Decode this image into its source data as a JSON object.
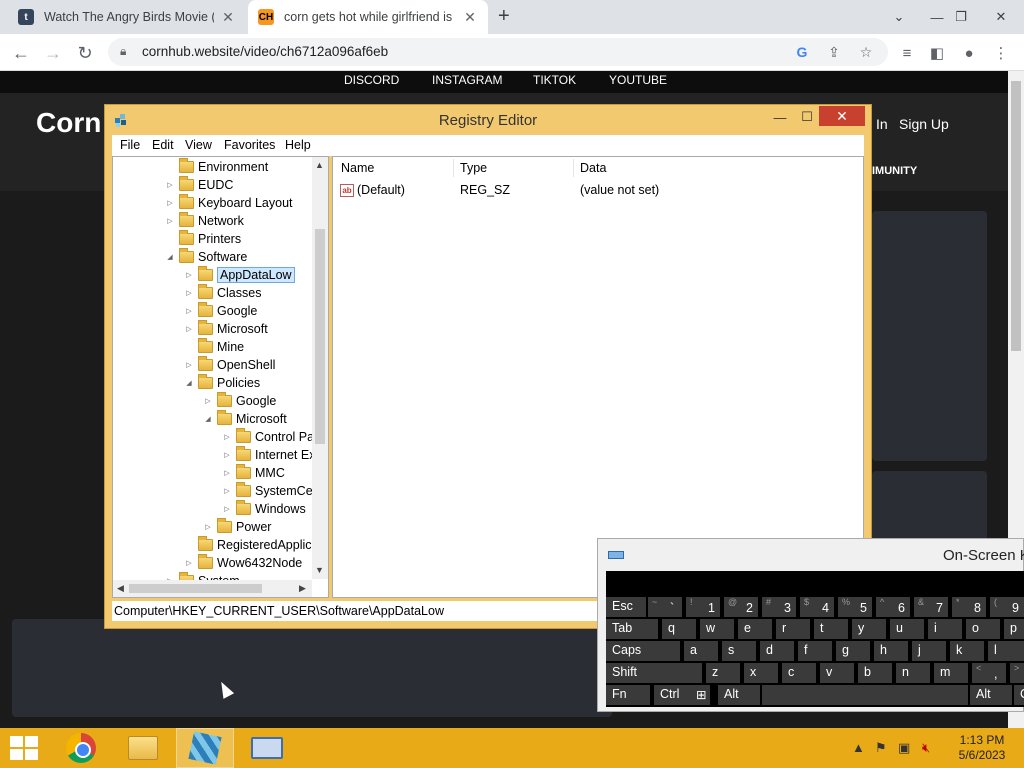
{
  "browser": {
    "tabs": [
      {
        "title": "Watch The Angry Birds Movie (2(",
        "favicon": "tumblr-icon",
        "active": false
      },
      {
        "title": "corn gets hot while girlfriend is b",
        "favicon": "CH",
        "active": true
      }
    ],
    "url": "cornhub.website/video/ch6712a096af6eb"
  },
  "site": {
    "nav": [
      "DISCORD",
      "INSTAGRAM",
      "TIKTOK",
      "YOUTUBE"
    ],
    "logo": "Corn",
    "login_partial": "In",
    "signup": "Sign Up",
    "community_partial": "IMUNITY"
  },
  "regedit": {
    "title": "Registry Editor",
    "menu": [
      "File",
      "Edit",
      "View",
      "Favorites",
      "Help"
    ],
    "tree": [
      {
        "label": "Environment",
        "expander": "",
        "depth": 0
      },
      {
        "label": "EUDC",
        "expander": "closed",
        "depth": 0
      },
      {
        "label": "Keyboard Layout",
        "expander": "closed",
        "depth": 0
      },
      {
        "label": "Network",
        "expander": "closed",
        "depth": 0
      },
      {
        "label": "Printers",
        "expander": "",
        "depth": 0
      },
      {
        "label": "Software",
        "expander": "open",
        "depth": 0
      },
      {
        "label": "AppDataLow",
        "expander": "closed",
        "depth": 1,
        "selected": true
      },
      {
        "label": "Classes",
        "expander": "closed",
        "depth": 1
      },
      {
        "label": "Google",
        "expander": "closed",
        "depth": 1
      },
      {
        "label": "Microsoft",
        "expander": "closed",
        "depth": 1
      },
      {
        "label": "Mine",
        "expander": "",
        "depth": 1
      },
      {
        "label": "OpenShell",
        "expander": "closed",
        "depth": 1
      },
      {
        "label": "Policies",
        "expander": "open",
        "depth": 1
      },
      {
        "label": "Google",
        "expander": "closed",
        "depth": 2
      },
      {
        "label": "Microsoft",
        "expander": "open",
        "depth": 2
      },
      {
        "label": "Control Pa",
        "expander": "closed",
        "depth": 3
      },
      {
        "label": "Internet Exp",
        "expander": "closed",
        "depth": 3
      },
      {
        "label": "MMC",
        "expander": "closed",
        "depth": 3
      },
      {
        "label": "SystemCer",
        "expander": "closed",
        "depth": 3
      },
      {
        "label": "Windows",
        "expander": "closed",
        "depth": 3
      },
      {
        "label": "Power",
        "expander": "closed",
        "depth": 2
      },
      {
        "label": "RegisteredApplica",
        "expander": "",
        "depth": 1
      },
      {
        "label": "Wow6432Node",
        "expander": "closed",
        "depth": 1
      },
      {
        "label": "System",
        "expander": "closed",
        "depth": 0
      }
    ],
    "columns": [
      "Name",
      "Type",
      "Data"
    ],
    "values": [
      {
        "name": "(Default)",
        "type": "REG_SZ",
        "data": "(value not set)"
      }
    ],
    "status": "Computer\\HKEY_CURRENT_USER\\Software\\AppDataLow"
  },
  "osk": {
    "title": "On-Screen K",
    "rows": [
      [
        {
          "label": "Esc"
        },
        {
          "sub": "~",
          "main": "`"
        },
        {
          "sub": "!",
          "main": "1"
        },
        {
          "sub": "@",
          "main": "2"
        },
        {
          "sub": "#",
          "main": "3"
        },
        {
          "sub": "$",
          "main": "4"
        },
        {
          "sub": "%",
          "main": "5"
        },
        {
          "sub": "^",
          "main": "6"
        },
        {
          "sub": "&",
          "main": "7"
        },
        {
          "sub": "*",
          "main": "8"
        },
        {
          "sub": "(",
          "main": "9"
        }
      ],
      [
        {
          "label": "Tab"
        },
        {
          "label": "q"
        },
        {
          "label": "w"
        },
        {
          "label": "e"
        },
        {
          "label": "r"
        },
        {
          "label": "t"
        },
        {
          "label": "y"
        },
        {
          "label": "u"
        },
        {
          "label": "i"
        },
        {
          "label": "o"
        },
        {
          "label": "p"
        }
      ],
      [
        {
          "label": "Caps"
        },
        {
          "label": "a"
        },
        {
          "label": "s"
        },
        {
          "label": "d"
        },
        {
          "label": "f"
        },
        {
          "label": "g"
        },
        {
          "label": "h"
        },
        {
          "label": "j"
        },
        {
          "label": "k"
        },
        {
          "label": "l"
        }
      ],
      [
        {
          "label": "Shift"
        },
        {
          "label": "z"
        },
        {
          "label": "x"
        },
        {
          "label": "c"
        },
        {
          "label": "v"
        },
        {
          "label": "b"
        },
        {
          "label": "n"
        },
        {
          "label": "m"
        },
        {
          "sub": "<",
          "main": ","
        },
        {
          "sub": ">",
          "main": "."
        }
      ],
      [
        {
          "label": "Fn"
        },
        {
          "label": "Ctrl"
        },
        {
          "label": "windows-icon"
        },
        {
          "label": "Alt"
        },
        {
          "label": ""
        },
        {
          "label": "Alt"
        },
        {
          "label": "Ct"
        }
      ]
    ]
  },
  "taskbar": {
    "items": [
      "start-button",
      "chrome-icon",
      "file-explorer-icon",
      "registry-editor-icon",
      "on-screen-keyboard-icon"
    ],
    "time": "1:13 PM",
    "date": "5/6/2023"
  }
}
